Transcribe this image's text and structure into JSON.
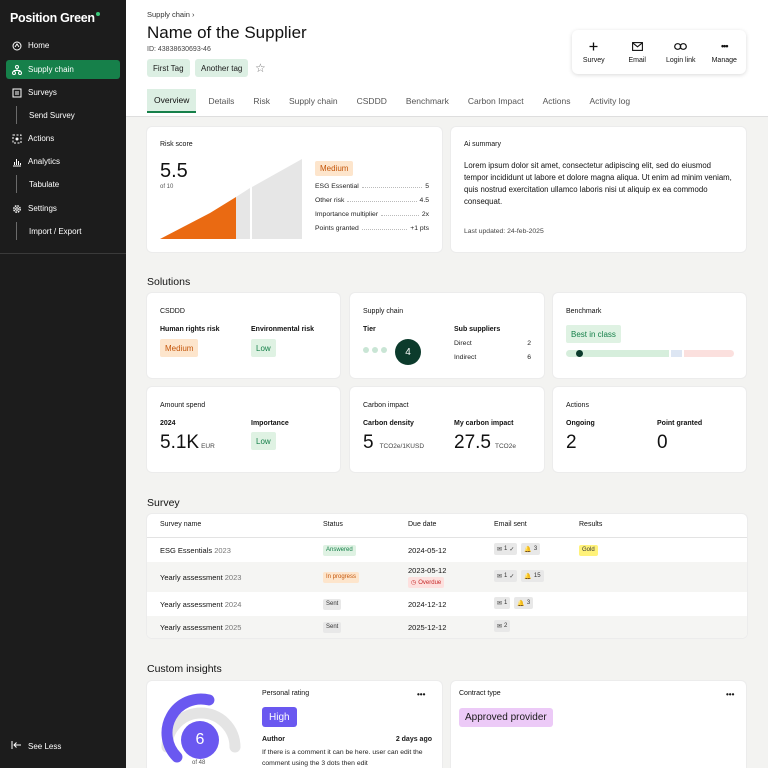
{
  "brand": {
    "name": "Position Green"
  },
  "sidebar": {
    "items": [
      {
        "label": "Home",
        "icon": "home-icon"
      },
      {
        "label": "Supply chain",
        "icon": "supply-chain-icon"
      },
      {
        "label": "Surveys",
        "icon": "surveys-icon"
      },
      {
        "label": "Send Survey"
      },
      {
        "label": "Actions",
        "icon": "actions-icon"
      },
      {
        "label": "Analytics",
        "icon": "analytics-icon"
      },
      {
        "label": "Tabulate"
      },
      {
        "label": "Settings",
        "icon": "settings-icon"
      },
      {
        "label": "Import / Export"
      }
    ],
    "see_less": "See Less"
  },
  "header": {
    "breadcrumb": "Supply chain",
    "title": "Name of the Supplier",
    "id": "ID: 43838630693-46",
    "tags": [
      "First Tag",
      "Another tag"
    ],
    "actions": [
      {
        "label": "Survey",
        "icon": "plus-icon"
      },
      {
        "label": "Email",
        "icon": "mail-icon"
      },
      {
        "label": "Login link",
        "icon": "link-icon"
      },
      {
        "label": "Manage",
        "icon": "more-icon"
      }
    ],
    "tabs": [
      "Overview",
      "Details",
      "Risk",
      "Supply chain",
      "CSDDD",
      "Benchmark",
      "Carbon Impact",
      "Actions",
      "Activity log"
    ]
  },
  "risk": {
    "title": "Risk score",
    "score": "5.5",
    "of": "of 10",
    "level": "Medium",
    "rows": [
      {
        "label": "ESG Essential",
        "value": "5"
      },
      {
        "label": "Other risk",
        "value": "4.5"
      },
      {
        "label": "Importance multiplier",
        "value": "2x"
      },
      {
        "label": "Points granted",
        "value": "+1 pts"
      }
    ],
    "colors": {
      "accent": "#ea6a12",
      "muted": "#e6e6e6"
    }
  },
  "ai": {
    "title": "Ai summary",
    "text": "Lorem ipsum dolor sit amet, consectetur adipiscing elit, sed do eiusmod tempor incididunt ut labore et dolore magna aliqua. Ut enim ad minim veniam, quis nostrud exercitation ullamco laboris nisi ut aliquip ex ea commodo consequat.",
    "updated": "Last updated: 24-feb-2025"
  },
  "solutions": {
    "heading": "Solutions",
    "csddd": {
      "title": "CSDDD",
      "hr_label": "Human rights risk",
      "hr_value": "Medium",
      "env_label": "Environmental risk",
      "env_value": "Low"
    },
    "supply": {
      "title": "Supply chain",
      "tier_label": "Tier",
      "tier_value": "4",
      "sub_label": "Sub suppliers",
      "direct_label": "Direct",
      "direct_value": "2",
      "indirect_label": "Indirect",
      "indirect_value": "6"
    },
    "benchmark": {
      "title": "Benchmark",
      "value": "Best in class",
      "position": 0.08
    },
    "spend": {
      "title": "Amount spend",
      "year": "2024",
      "amount": "5.1K",
      "currency": "EUR",
      "imp_label": "Importance",
      "imp_value": "Low"
    },
    "carbon": {
      "title": "Carbon impact",
      "density_label": "Carbon density",
      "density_value": "5",
      "density_unit": "TCO2e/1KUSD",
      "my_label": "My carbon impact",
      "my_value": "27.5",
      "my_unit": "TCO2e"
    },
    "actions": {
      "title": "Actions",
      "ongoing_label": "Ongoing",
      "ongoing_value": "2",
      "point_label": "Point granted",
      "point_value": "0"
    }
  },
  "survey": {
    "heading": "Survey",
    "columns": [
      "Survey name",
      "Status",
      "Due date",
      "Email sent",
      "Results"
    ],
    "rows": [
      {
        "name": "ESG Essentials",
        "year": "2023",
        "status": "Answered",
        "due": "2024-05-12",
        "overdue": "",
        "mail": "1",
        "mail_check": "✓",
        "bell": "3",
        "result": "Gold"
      },
      {
        "name": "Yearly assessment",
        "year": "2023",
        "status": "In progress",
        "due": "2023-05-12",
        "overdue": "Overdue",
        "mail": "1",
        "mail_check": "✓",
        "bell": "15",
        "result": ""
      },
      {
        "name": "Yearly assessment",
        "year": "2024",
        "status": "Sent",
        "due": "2024-12-12",
        "overdue": "",
        "mail": "1",
        "mail_check": "",
        "bell": "3",
        "result": ""
      },
      {
        "name": "Yearly assessment",
        "year": "2025",
        "status": "Sent",
        "due": "2025-12-12",
        "overdue": "",
        "mail": "2",
        "mail_check": "",
        "bell": "",
        "result": ""
      }
    ]
  },
  "insights": {
    "heading": "Custom insights",
    "rating": {
      "value": "6",
      "of": "of 48",
      "fraction": 0.55
    },
    "personal": {
      "title": "Personal rating",
      "value": "High",
      "author_label": "Author",
      "time": "2 days ago",
      "comment": "If there is a comment it can be here. user can edit the comment using the 3 dots then edit"
    },
    "contract": {
      "title": "Contract type",
      "value": "Approved provider"
    },
    "more": "•••"
  }
}
